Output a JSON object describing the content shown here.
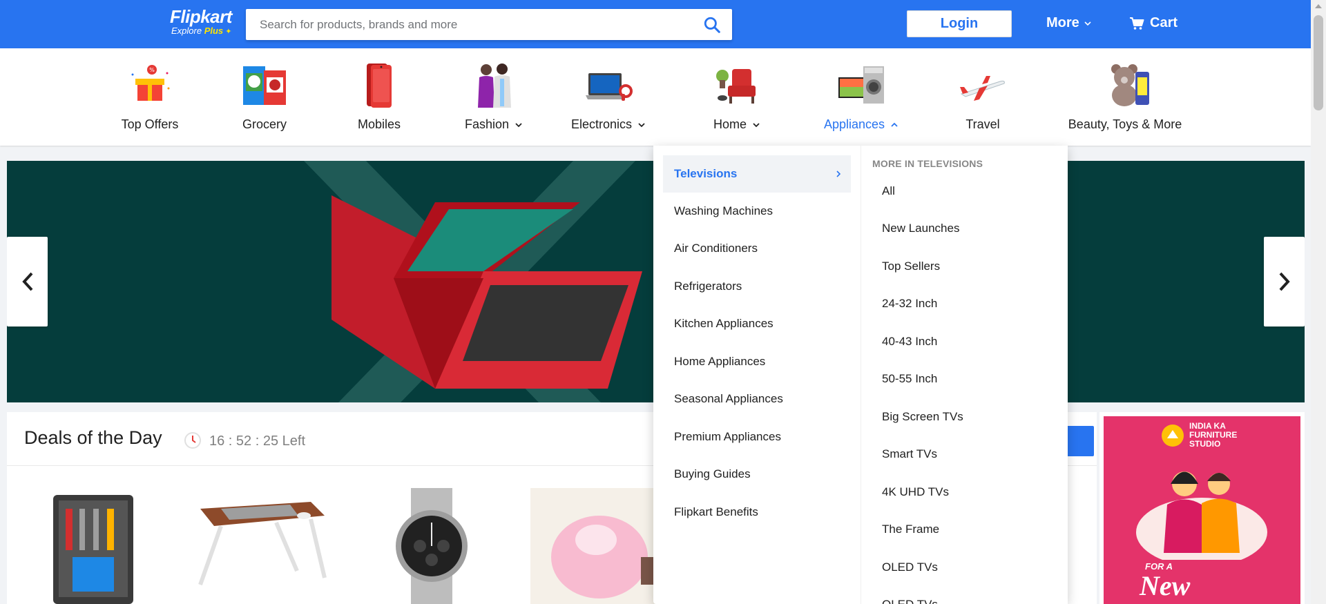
{
  "header": {
    "brand": "Flipkart",
    "tagline": "Explore",
    "tagline_plus": "Plus",
    "search_placeholder": "Search for products, brands and more",
    "login_label": "Login",
    "more_label": "More",
    "cart_label": "Cart"
  },
  "categories": [
    {
      "label": "Top Offers",
      "icon": "gift-icon",
      "has_menu": false
    },
    {
      "label": "Grocery",
      "icon": "grocery-icon",
      "has_menu": false
    },
    {
      "label": "Mobiles",
      "icon": "mobile-icon",
      "has_menu": false
    },
    {
      "label": "Fashion",
      "icon": "fashion-icon",
      "has_menu": true
    },
    {
      "label": "Electronics",
      "icon": "laptop-icon",
      "has_menu": true
    },
    {
      "label": "Home",
      "icon": "armchair-icon",
      "has_menu": true
    },
    {
      "label": "Appliances",
      "icon": "appliances-icon",
      "has_menu": true,
      "active": true
    },
    {
      "label": "Travel",
      "icon": "airplane-icon",
      "has_menu": false
    },
    {
      "label": "Beauty, Toys & More",
      "icon": "teddy-icon",
      "has_menu": true
    }
  ],
  "dropdown": {
    "items": [
      "Televisions",
      "Washing Machines",
      "Air Conditioners",
      "Refrigerators",
      "Kitchen Appliances",
      "Home Appliances",
      "Seasonal Appliances",
      "Premium Appliances",
      "Buying Guides",
      "Flipkart Benefits"
    ],
    "active_item": "Televisions",
    "more_heading": "MORE IN TELEVISIONS",
    "subitems": [
      "All",
      "New Launches",
      "Top Sellers",
      "24-32 Inch",
      "40-43 Inch",
      "50-55 Inch",
      "Big Screen TVs",
      "Smart TVs",
      "4K UHD TVs",
      "The Frame",
      "OLED TVs",
      "QLED TVs"
    ]
  },
  "deals": {
    "title": "Deals of the Day",
    "timer": "16 : 52 : 25 Left"
  },
  "ad": {
    "line1": "INDIA KA",
    "line2": "FURNITURE",
    "line3": "STUDIO",
    "bottom_small": "FOR A",
    "bottom_big": "New"
  },
  "colors": {
    "brand_blue": "#2874f0",
    "brand_yellow": "#ffe500",
    "banner_bg": "#053d3c"
  }
}
